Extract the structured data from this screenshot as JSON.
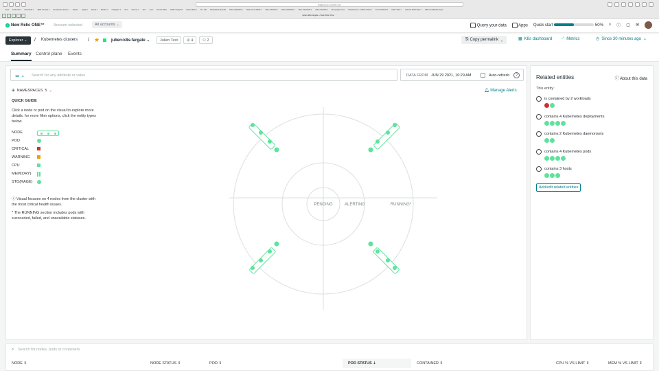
{
  "browser": {
    "url": "staging-one.newrelic.com",
    "tab_title": "Julien-k8s-fargate • New Relic One",
    "bookmarks": [
      "Eiuo",
      "Financial ▾",
      "New Relic ▾",
      "AWS Console ▾",
      "DevOps Pro Exam ▾",
      "Read ▾",
      "Apple ▾",
      "Social ▾",
      "Monitor ▾",
      "Instagram ▾",
      "VK ▾",
      "Forums ▾",
      "AV ▾",
      "arxiv",
      "Sound Video",
      "GRTH Analytics",
      "Saved Tabs ▾",
      "TI ▾ Ofe",
      "Rocketbide Benefits",
      "Tabs 2/11/2020 ▾",
      "Tabs 2/2 10:00/20 ▾",
      "Tabs 2/2/2020 ▾",
      "Tabs 2/18/2020 ▾",
      "Tabs 4/21/2020 ▾",
      "Tabs 2/1/2020 ▾",
      "Homepage Links",
      "Infrastructure, & What's New ▾",
      "To Do 6/16/18 ▾",
      "Video Tabs ▾",
      "relevant 2020 Tabs ▾",
      "AWS Certification login"
    ]
  },
  "topnav": {
    "product": "New Relic ONE™",
    "account_label": "Account selected",
    "account_value": "All accounts",
    "query_label": "Query your data",
    "apps_label": "Apps",
    "quick_start_label": "Quick start",
    "quick_start_percent": "50%",
    "quick_start_fraction": 0.5
  },
  "breadcrumb": {
    "explorer": "Explorer",
    "section": "Kubernetes clusters",
    "entity": "julien-k8s-fargate",
    "account": "Julien Test",
    "tags_count": "4",
    "users_count": "2",
    "copy_permalink": "Copy permalink",
    "k8s_dashboard": "K8s dashboard",
    "metrics": "Metrics",
    "time_range": "Since 30 minutes ago"
  },
  "tabs": [
    "Summary",
    "Control plane",
    "Events"
  ],
  "filter": {
    "placeholder": "Search for any attribute or value",
    "data_from_label": "DATA FROM",
    "data_from_value": "JUN 29 2021, 10:29 AM",
    "auto_refresh": "Auto-refresh",
    "help": "?"
  },
  "legend": {
    "namespaces": "NAMESPACES",
    "namespaces_count": "5",
    "quick_guide": "QUICK GUIDE",
    "guide_text": "Click a node or pod on the visual to explore more details. for more filter options, click the entity types below.",
    "items": [
      "NODE",
      "POD",
      "CRITICAL",
      "WARNING",
      "CPU",
      "MEM(ORY)",
      "STO(RAGE)"
    ],
    "focus_text": "Visual focuses on 4 nodes from the cluster with the most critical health issues.",
    "running_note": "* The RUNNING section includes pods with succeeded, failed, and unavailable statuses."
  },
  "viz": {
    "manage_alerts": "Manage Alerts",
    "labels": [
      "PENDING",
      "ALERTING",
      "RUNNING*"
    ]
  },
  "related": {
    "title": "Related entities",
    "about": "About this data",
    "this_entity": "This entity:",
    "items": [
      {
        "text": "is contained by 2 workloads",
        "dots": [
          "red",
          "green"
        ]
      },
      {
        "text": "contains 4 Kubernetes deployments",
        "dots": [
          "green",
          "green",
          "green",
          "green"
        ]
      },
      {
        "text": "contains 2 Kubernetes daemonsets",
        "dots": [
          "green",
          "green"
        ]
      },
      {
        "text": "contains 4 Kubernetes pods",
        "dots": [
          "green",
          "green",
          "green",
          "green"
        ]
      },
      {
        "text": "contains 3 hosts",
        "dots": [
          "green",
          "green",
          "green"
        ]
      }
    ],
    "add_button": "Add/edit related entities"
  },
  "table": {
    "search_placeholder": "Search for nodes, pods or containers",
    "columns": [
      "NODE",
      "NODE STATUS",
      "POD",
      "POD STATUS",
      "CONTAINER",
      "CPU % VS LIMIT",
      "MEM % VS LIMIT"
    ],
    "sorted_column": "POD STATUS"
  },
  "colors": {
    "accent": "#007e8a",
    "healthy": "#5fe29d",
    "critical": "#d32e2e",
    "warning": "#e8a200",
    "dark": "#293338"
  }
}
